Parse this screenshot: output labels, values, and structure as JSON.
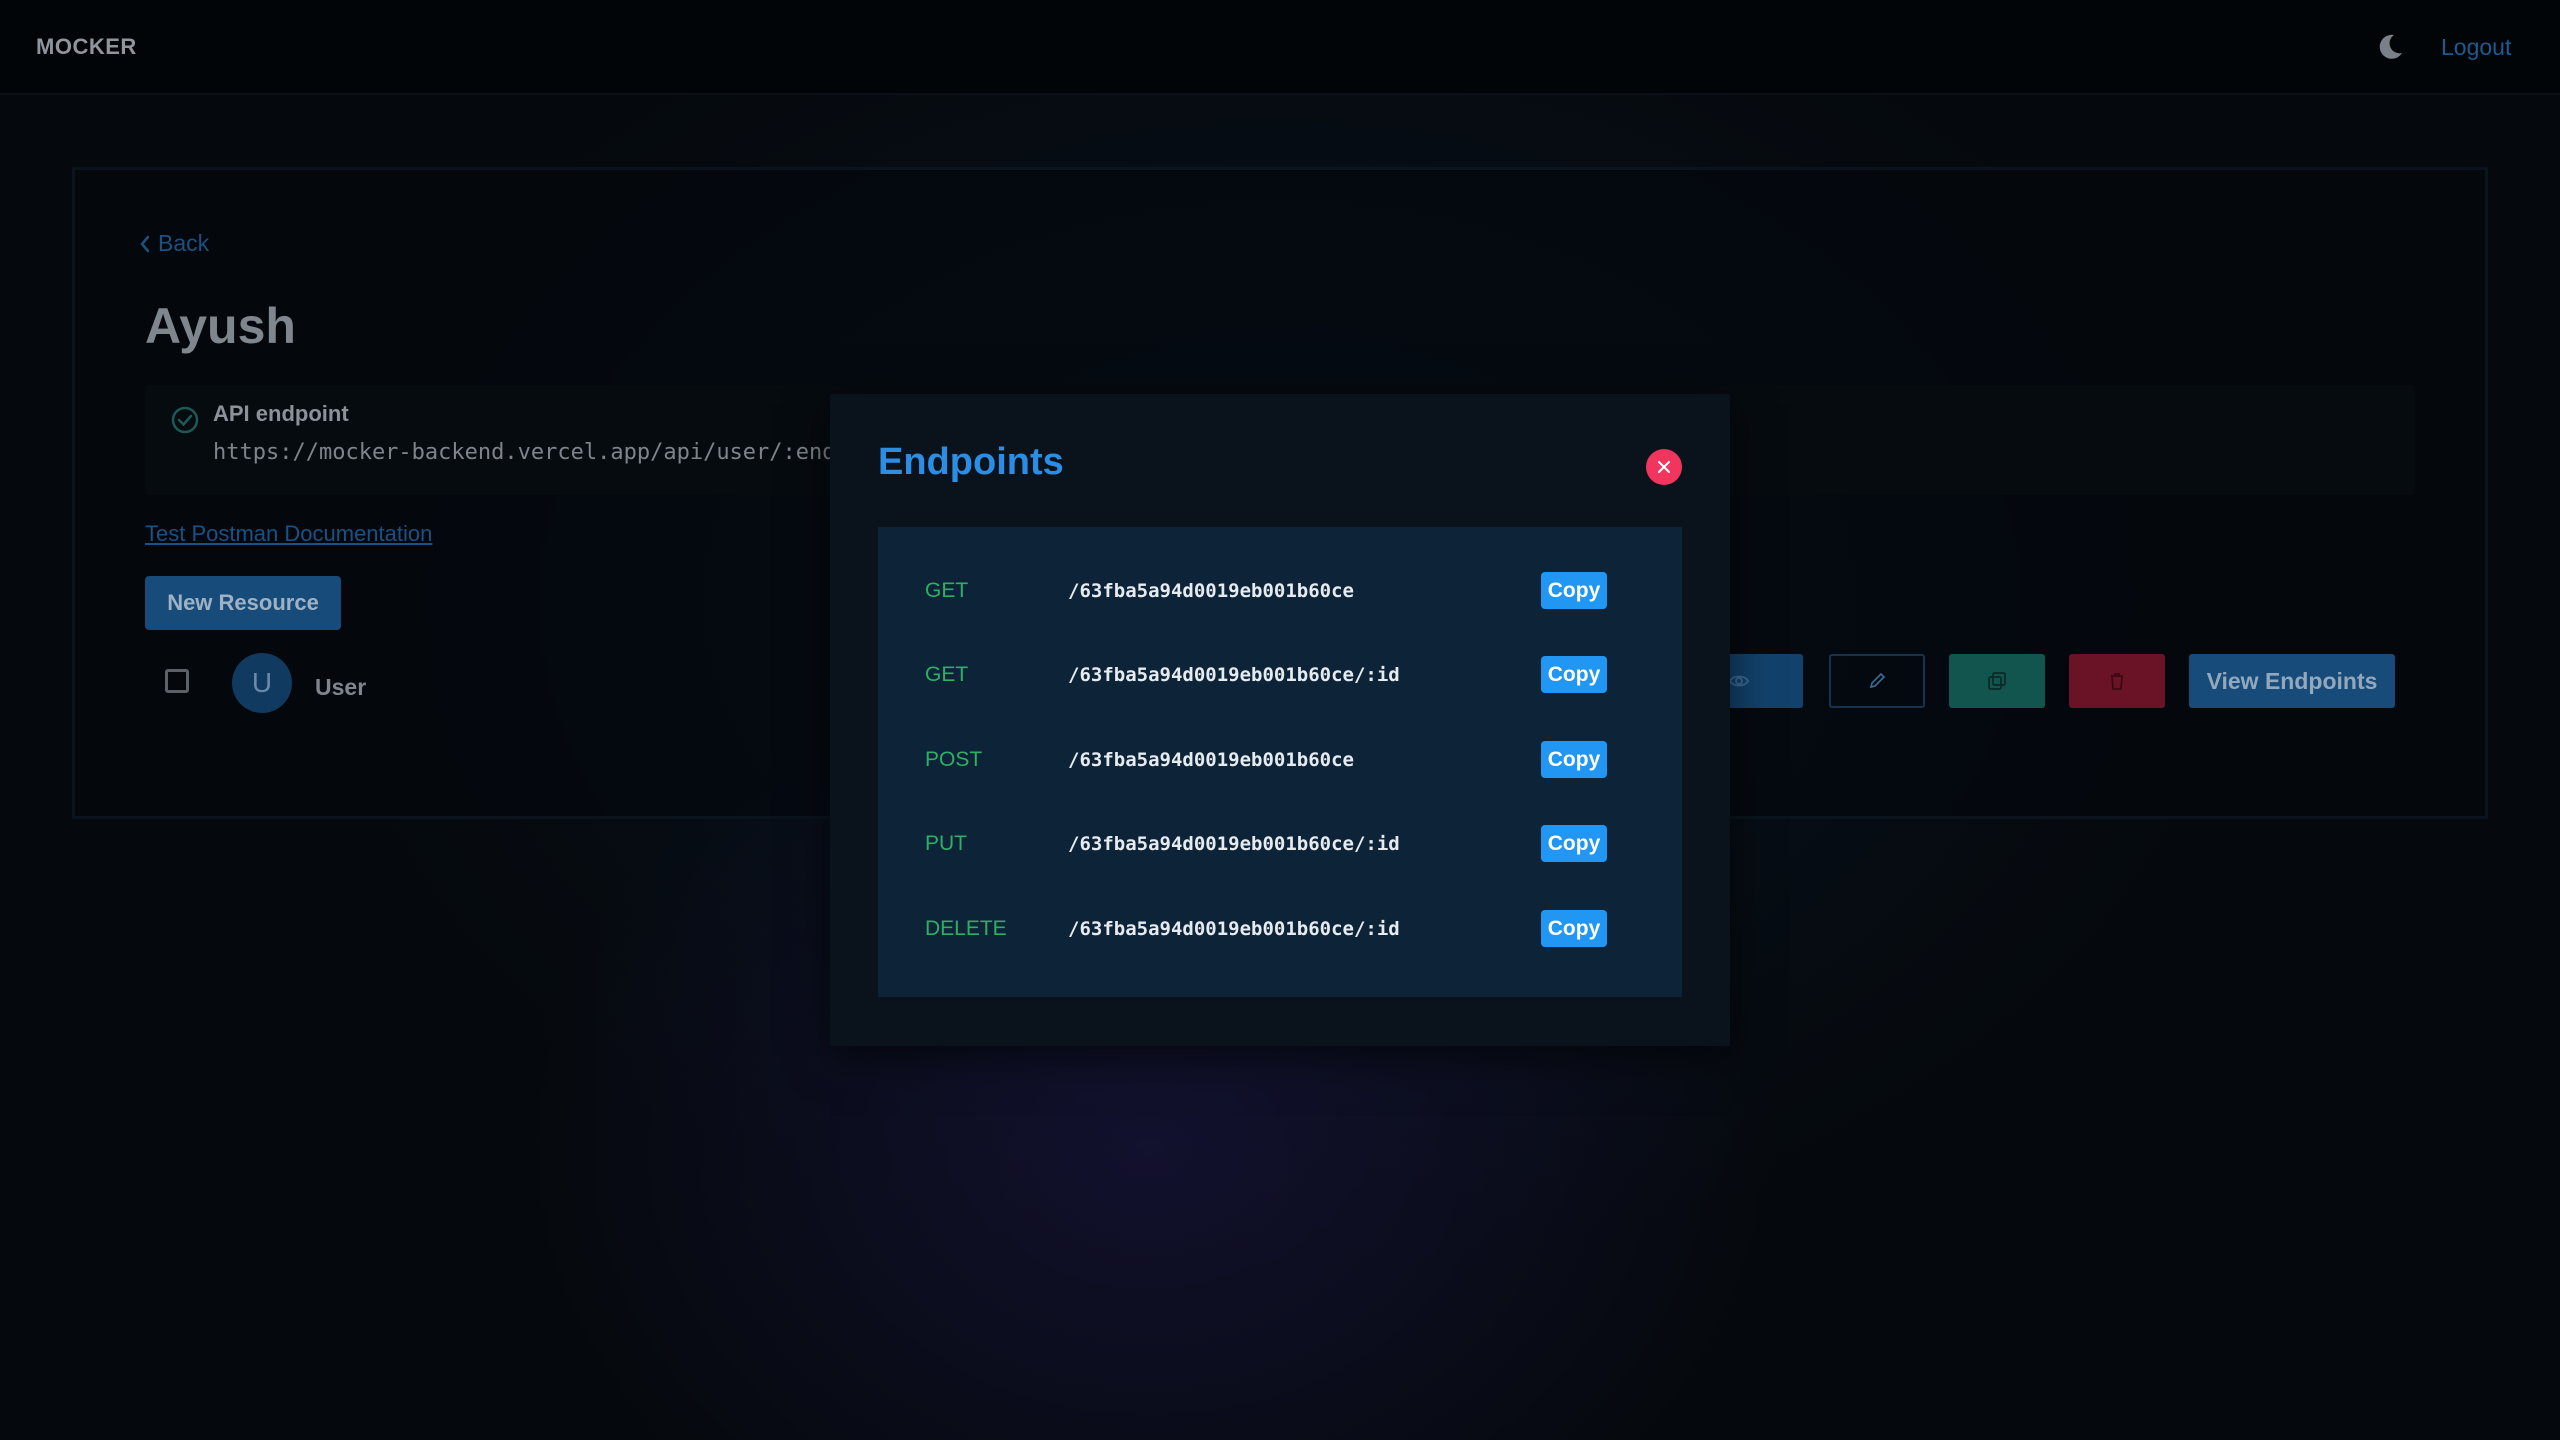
{
  "navbar": {
    "brand": "MOCKER",
    "logout_label": "Logout"
  },
  "page": {
    "back_label": "Back",
    "title": "Ayush",
    "api_endpoint_label": "API endpoint",
    "api_endpoint_url": "https://mocker-backend.vercel.app/api/user/:endpo",
    "postman_link": "Test Postman Documentation",
    "new_resource_label": "New Resource"
  },
  "resource": {
    "avatar_letter": "U",
    "name": "User",
    "view_endpoints_label": "View Endpoints"
  },
  "modal": {
    "title": "Endpoints",
    "copy_label": "Copy",
    "endpoints": [
      {
        "method": "GET",
        "path": "/63fba5a94d0019eb001b60ce"
      },
      {
        "method": "GET",
        "path": "/63fba5a94d0019eb001b60ce/:id"
      },
      {
        "method": "POST",
        "path": "/63fba5a94d0019eb001b60ce"
      },
      {
        "method": "PUT",
        "path": "/63fba5a94d0019eb001b60ce/:id"
      },
      {
        "method": "DELETE",
        "path": "/63fba5a94d0019eb001b60ce/:id"
      }
    ]
  },
  "colors": {
    "accent": "#2196f3",
    "method_green": "#2faf64",
    "close_red": "#f0355f",
    "modal_title": "#2b8de3"
  },
  "icons": [
    "moon-icon",
    "chevron-left-icon",
    "check-circle-icon",
    "eye-icon",
    "pencil-icon",
    "copy-icon",
    "trash-icon",
    "close-icon"
  ]
}
